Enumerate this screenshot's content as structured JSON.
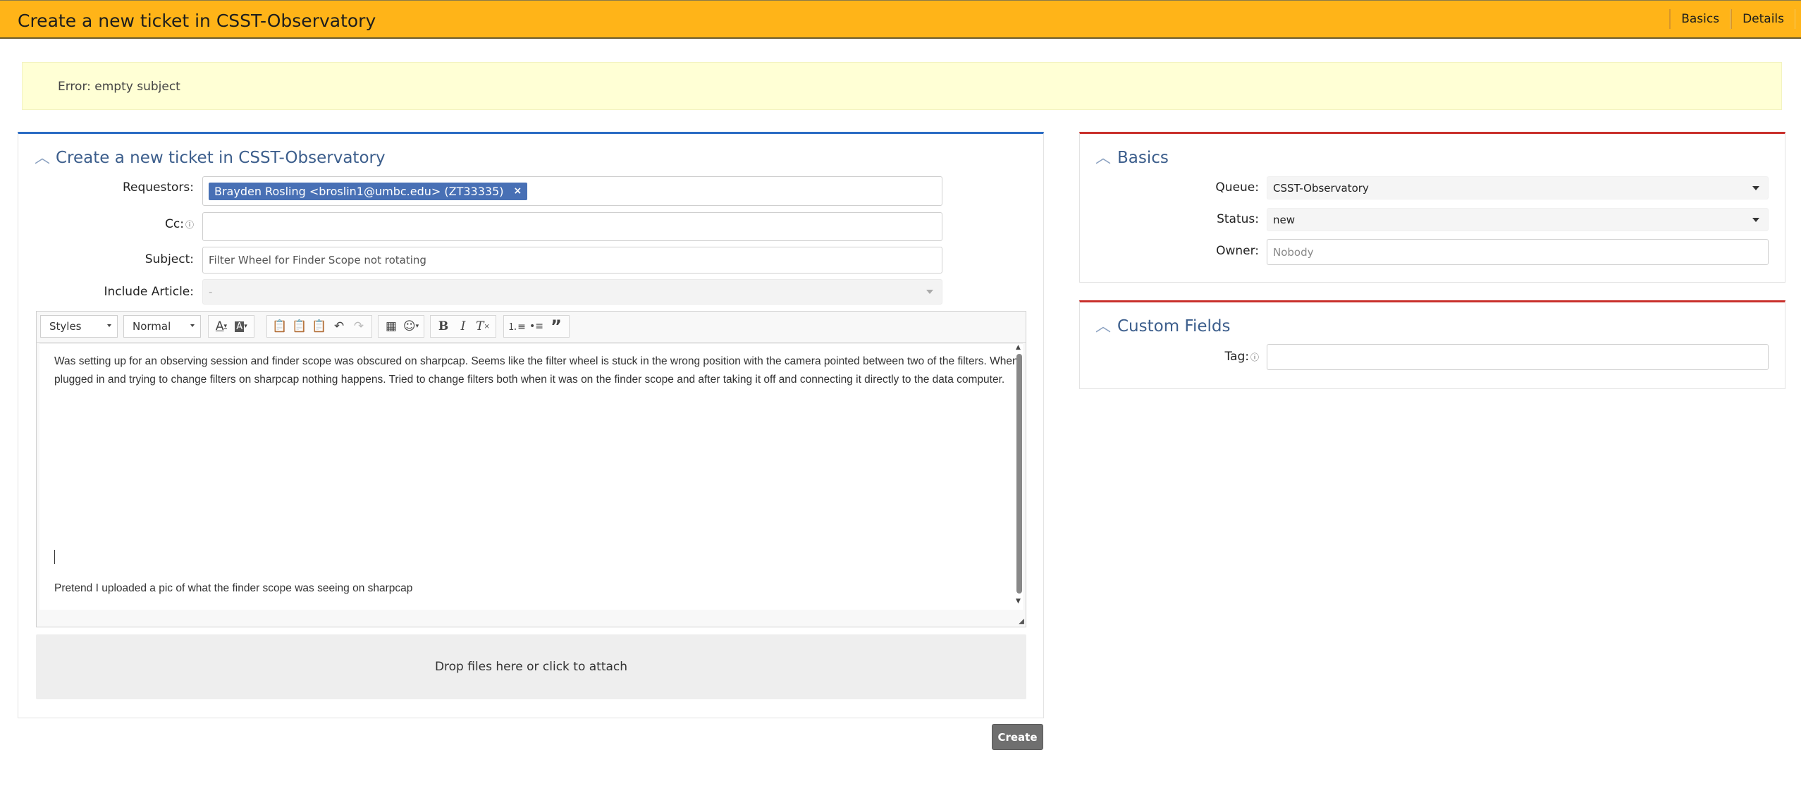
{
  "header": {
    "title": "Create a new ticket in CSST-Observatory",
    "tabs": [
      {
        "label": "Basics"
      },
      {
        "label": "Details"
      }
    ]
  },
  "error": {
    "message": "Error: empty subject"
  },
  "ticket_panel": {
    "title": "Create a new ticket in CSST-Observatory",
    "requestors_label": "Requestors:",
    "requestor_chip": "Brayden Rosling <broslin1@umbc.edu> (ZT33335)",
    "requestor_remove": "×",
    "cc_label": "Cc:",
    "help_glyph": "ⓘ",
    "subject_label": "Subject:",
    "subject_value": "Filter Wheel for Finder Scope not rotating",
    "article_label": "Include Article:",
    "article_value": "-"
  },
  "editor": {
    "styles": "Styles",
    "format": "Normal",
    "body_paragraph": "Was setting up for an observing session and finder scope was obscured on sharpcap. Seems like the filter wheel is stuck in the wrong position with the camera pointed between two of the filters. When plugged in and trying to change filters on sharpcap nothing happens. Tried to change filters both when it was on the finder scope and after taking it off and connecting it directly to the data computer.",
    "body_note": "Pretend I uploaded a pic of what the finder scope was seeing on sharpcap"
  },
  "dropzone": {
    "label": "Drop files here or click to attach"
  },
  "create_button": {
    "label": "Create"
  },
  "basics_panel": {
    "title": "Basics",
    "queue_label": "Queue:",
    "queue_value": "CSST-Observatory",
    "status_label": "Status:",
    "status_value": "new",
    "owner_label": "Owner:",
    "owner_placeholder": "Nobody"
  },
  "custom_fields_panel": {
    "title": "Custom Fields",
    "tag_label": "Tag:"
  },
  "colors": {
    "header_bg": "#ffb418",
    "primary_accent": "#2a6cc4",
    "secondary_accent": "#c9302c",
    "chip_bg": "#4870b5",
    "error_bg": "#ffffd5"
  }
}
